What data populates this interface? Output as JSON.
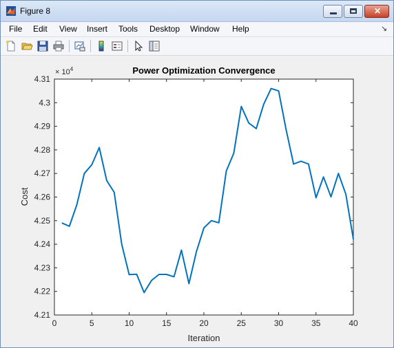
{
  "window": {
    "title": "Figure 8",
    "close_glyph": "✕"
  },
  "menu": {
    "items": [
      "File",
      "Edit",
      "View",
      "Insert",
      "Tools",
      "Desktop",
      "Window",
      "Help"
    ],
    "overflow_glyph": "↘"
  },
  "toolbar": {
    "icons": [
      "new-figure-icon",
      "open-file-icon",
      "save-icon",
      "print-icon",
      "link-plot-icon",
      "colorbar-icon",
      "legend-icon",
      "pointer-icon",
      "property-editor-icon"
    ]
  },
  "axes_multiplier": {
    "base": "× 10",
    "exponent": "4"
  },
  "chart_data": {
    "type": "line",
    "title": "Power Optimization Convergence",
    "xlabel": "Iteration",
    "ylabel": "Cost",
    "xlim": [
      0,
      40
    ],
    "ylim": [
      42100,
      43100
    ],
    "xticks": [
      0,
      5,
      10,
      15,
      20,
      25,
      30,
      35,
      40
    ],
    "xtick_labels": [
      "0",
      "5",
      "10",
      "15",
      "20",
      "25",
      "30",
      "35",
      "40"
    ],
    "yticks": [
      42100,
      42200,
      42300,
      42400,
      42500,
      42600,
      42700,
      42800,
      42900,
      43000,
      43100
    ],
    "ytick_labels": [
      "4.21",
      "4.22",
      "4.23",
      "4.24",
      "4.25",
      "4.26",
      "4.27",
      "4.28",
      "4.29",
      "4.3",
      "4.31"
    ],
    "grid": false,
    "series": [
      {
        "color": "#0072bd",
        "x": [
          1,
          2,
          3,
          4,
          5,
          6,
          7,
          8,
          9,
          10,
          11,
          12,
          13,
          14,
          15,
          16,
          17,
          18,
          19,
          20,
          21,
          22,
          23,
          24,
          25,
          26,
          27,
          28,
          29,
          30,
          31,
          32,
          33,
          34,
          35,
          36,
          37,
          38,
          39,
          40
        ],
        "y": [
          42490,
          42476,
          42567,
          42700,
          42737,
          42810,
          42670,
          42620,
          42400,
          42271,
          42273,
          42195,
          42247,
          42272,
          42272,
          42262,
          42375,
          42233,
          42368,
          42469,
          42500,
          42491,
          42710,
          42786,
          42984,
          42914,
          42890,
          42993,
          43060,
          43050,
          42885,
          42740,
          42752,
          42740,
          42597,
          42685,
          42601,
          42700,
          42612,
          42421
        ]
      }
    ]
  }
}
